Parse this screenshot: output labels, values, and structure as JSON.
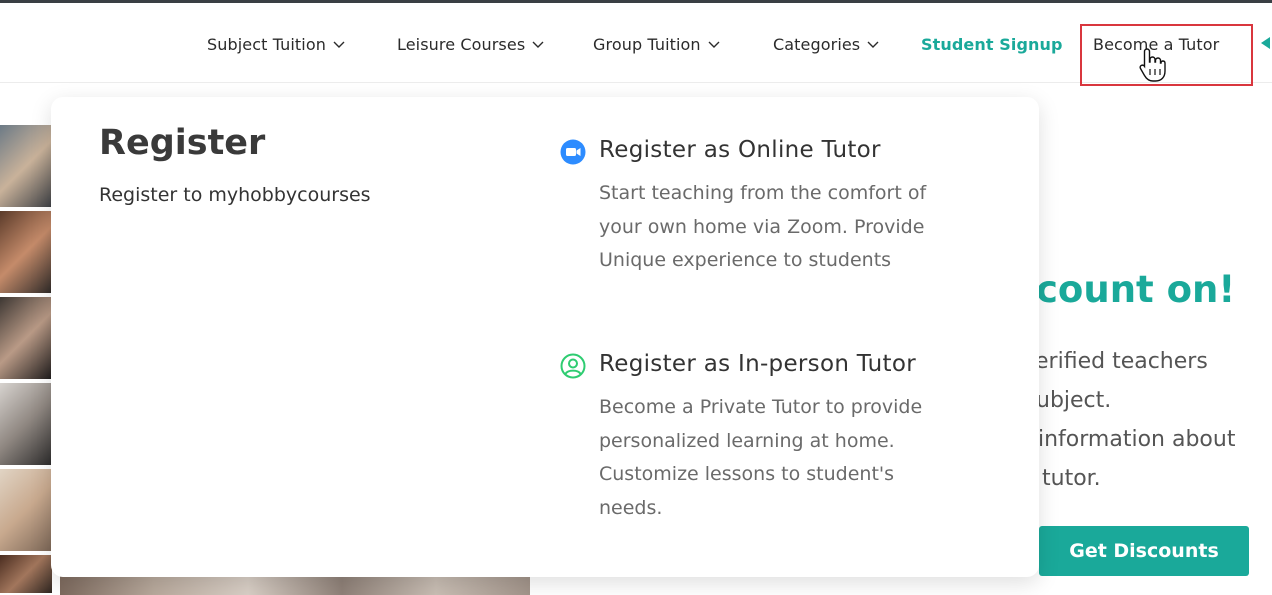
{
  "nav": {
    "items": [
      {
        "label": "Subject Tuition",
        "dropdown": true
      },
      {
        "label": "Leisure Courses",
        "dropdown": true
      },
      {
        "label": "Group Tuition",
        "dropdown": true
      },
      {
        "label": "Categories",
        "dropdown": true
      },
      {
        "label": "Student Signup",
        "dropdown": false
      },
      {
        "label": "Become a Tutor",
        "dropdown": false
      }
    ]
  },
  "dropdown": {
    "title": "Register",
    "subtitle": "Register to myhobbycourses",
    "options": [
      {
        "icon": "video-camera-icon",
        "title": "Register as Online Tutor",
        "description": "Start teaching from the comfort of your own home via Zoom. Provide Unique experience to students"
      },
      {
        "icon": "user-circle-icon",
        "title": "Register as In-person Tutor",
        "description": "Become a Private Tutor to provide personalized learning at home. Customize lessons to student's needs."
      }
    ]
  },
  "background": {
    "heading_fragment": "count on!",
    "lines": [
      "verified teachers",
      "ubject.",
      "information about",
      "tutor."
    ],
    "button_label": "Get Discounts"
  },
  "colors": {
    "accent": "#1aa99a",
    "zoom_blue": "#2d8cff",
    "person_green": "#2ecc71",
    "highlight_red": "#d9363e"
  }
}
